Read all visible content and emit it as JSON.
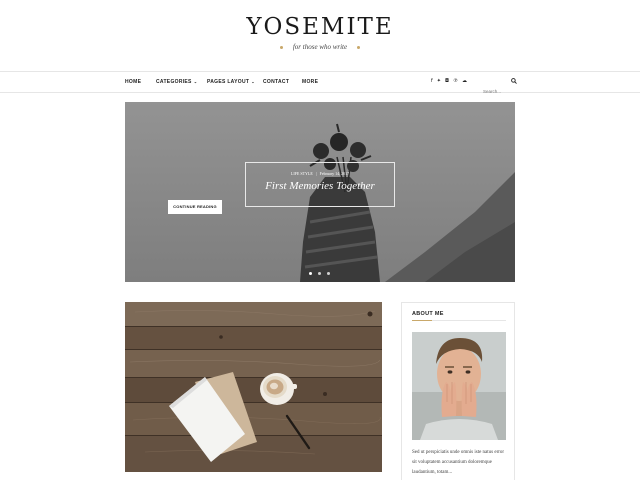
{
  "site": {
    "title": "YOSEMITE",
    "tagline": "for those who write"
  },
  "nav": {
    "items": [
      {
        "label": "HOME",
        "has_dropdown": false
      },
      {
        "label": "CATEGORIES",
        "has_dropdown": true
      },
      {
        "label": "PAGES LAYOUT",
        "has_dropdown": true
      },
      {
        "label": "CONTACT",
        "has_dropdown": false
      },
      {
        "label": "MORE",
        "has_dropdown": false
      }
    ],
    "social": [
      "facebook-icon",
      "twitter-icon",
      "instagram-icon",
      "pinterest-icon",
      "soundcloud-icon"
    ],
    "search_placeholder": "Search..."
  },
  "slider": {
    "category": "LIFE STYLE",
    "date": "February 14, 2017",
    "title": "First Memories Together",
    "button_label": "CONTINUE READING",
    "active_slide": 1,
    "slide_count": 3
  },
  "sidebar": {
    "about": {
      "title": "ABOUT ME",
      "text": "Sed ut perspiciatis unde omnis iste natus error sit voluptatem accusantium doloremque laudantium, totam..."
    }
  },
  "colors": {
    "accent": "#c9a86a",
    "text": "#222222",
    "border": "#e6e6e6"
  }
}
